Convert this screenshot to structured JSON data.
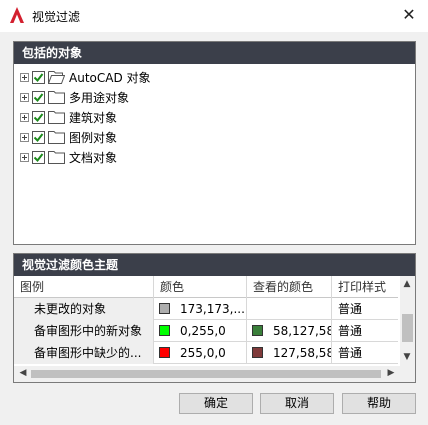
{
  "window": {
    "title": "视觉过滤",
    "close_glyph": "✕",
    "app_icon_letter": "A"
  },
  "objects_panel": {
    "header": "包括的对象",
    "items": [
      {
        "label": "AutoCAD 对象",
        "checked": true,
        "open_folder": true
      },
      {
        "label": "多用途对象",
        "checked": true,
        "open_folder": false
      },
      {
        "label": "建筑对象",
        "checked": true,
        "open_folder": false
      },
      {
        "label": "图例对象",
        "checked": true,
        "open_folder": false
      },
      {
        "label": "文档对象",
        "checked": true,
        "open_folder": false
      }
    ]
  },
  "theme_panel": {
    "header": "视觉过滤颜色主题",
    "columns": [
      "图例",
      "颜色",
      "查看的颜色",
      "打印样式"
    ],
    "rows": [
      {
        "name": "未更改的对象",
        "color": "173,173,...",
        "color_hex": "#adadad",
        "viewed_color": "",
        "viewed_hex": "",
        "plot_style": "普通"
      },
      {
        "name": "备审图形中的新对象",
        "color": "0,255,0",
        "color_hex": "#00ff00",
        "viewed_color": "58,127,58",
        "viewed_hex": "#3a7f3a",
        "plot_style": "普通"
      },
      {
        "name": "备审图形中缺少的...",
        "color": "255,0,0",
        "color_hex": "#ff0000",
        "viewed_color": "127,58,58",
        "viewed_hex": "#7f3a3a",
        "plot_style": "普通"
      }
    ]
  },
  "buttons": {
    "ok": "确定",
    "cancel": "取消",
    "help": "帮助"
  },
  "colors": {
    "panel_header": "#3b3f4a",
    "checkbox_check": "#1b8a1b",
    "app_icon": "#d3202f"
  }
}
